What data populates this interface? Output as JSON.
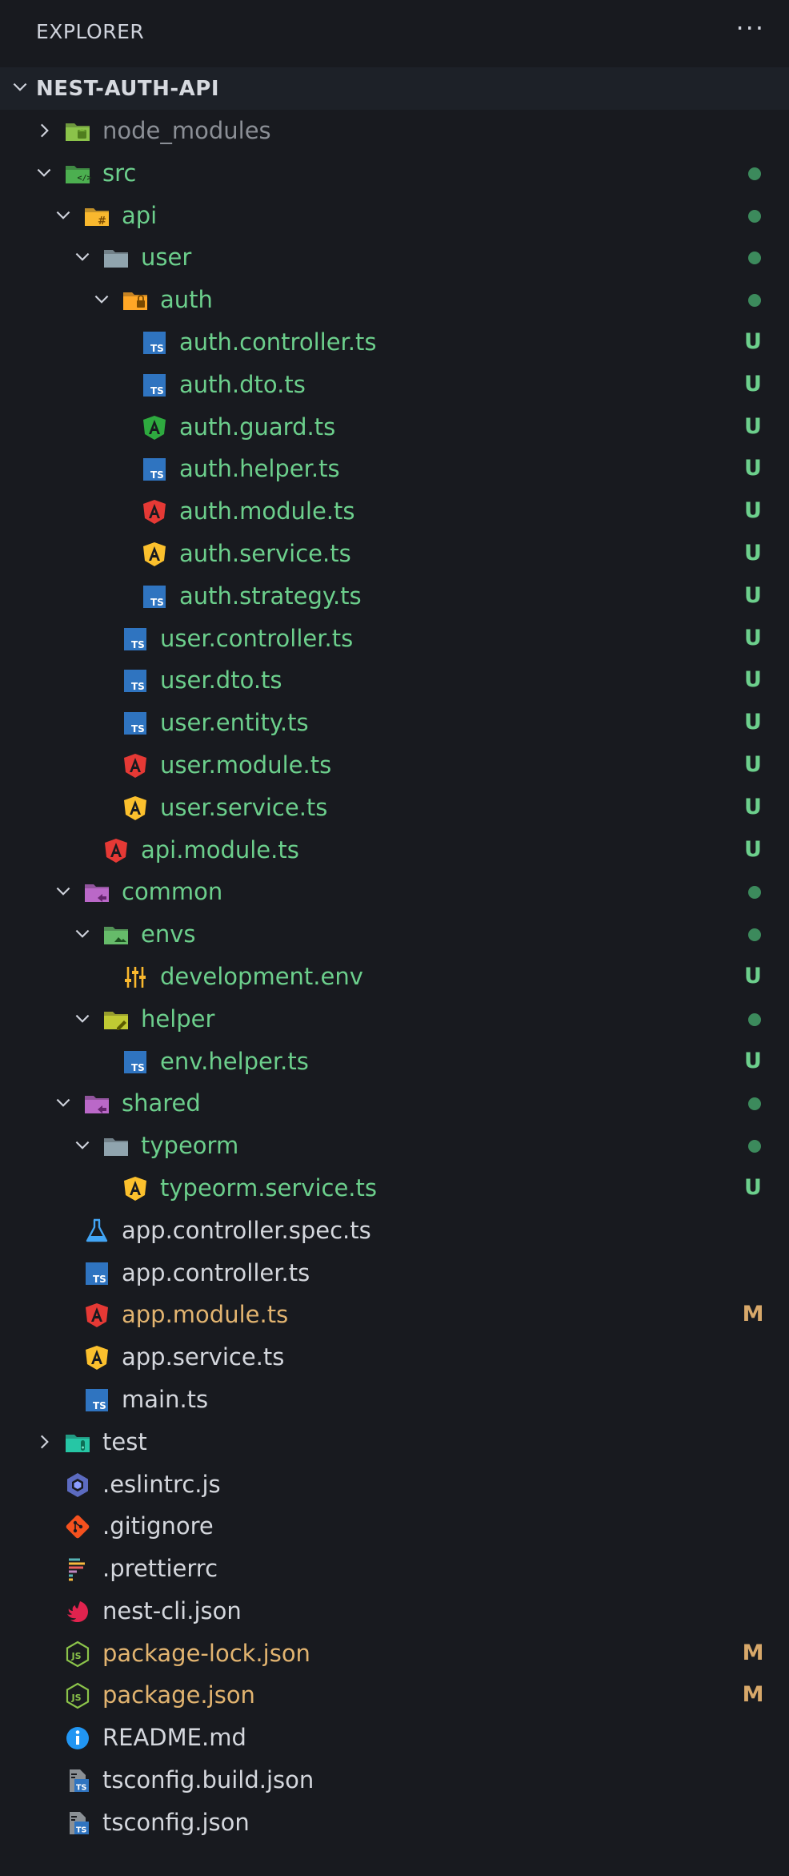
{
  "header": {
    "title": "EXPLORER",
    "more": "···"
  },
  "project": {
    "name": "NEST-AUTH-API"
  },
  "tree": [
    {
      "name": "node_modules",
      "depth": 0,
      "type": "folder",
      "expanded": false,
      "icon": "node-modules-folder-icon",
      "color": "grey",
      "status": ""
    },
    {
      "name": "src",
      "depth": 0,
      "type": "folder",
      "expanded": true,
      "icon": "src-folder-icon",
      "color": "green",
      "status": "dot"
    },
    {
      "name": "api",
      "depth": 1,
      "type": "folder",
      "expanded": true,
      "icon": "api-folder-icon",
      "color": "green",
      "status": "dot"
    },
    {
      "name": "user",
      "depth": 2,
      "type": "folder",
      "expanded": true,
      "icon": "folder-icon",
      "color": "green",
      "status": "dot"
    },
    {
      "name": "auth",
      "depth": 3,
      "type": "folder",
      "expanded": true,
      "icon": "auth-folder-icon",
      "color": "green",
      "status": "dot"
    },
    {
      "name": "auth.controller.ts",
      "depth": 4,
      "type": "file",
      "icon": "ts-icon",
      "color": "green",
      "status": "U"
    },
    {
      "name": "auth.dto.ts",
      "depth": 4,
      "type": "file",
      "icon": "ts-icon",
      "color": "green",
      "status": "U"
    },
    {
      "name": "auth.guard.ts",
      "depth": 4,
      "type": "file",
      "icon": "angular-guard-icon",
      "color": "green",
      "status": "U"
    },
    {
      "name": "auth.helper.ts",
      "depth": 4,
      "type": "file",
      "icon": "ts-icon",
      "color": "green",
      "status": "U"
    },
    {
      "name": "auth.module.ts",
      "depth": 4,
      "type": "file",
      "icon": "angular-module-icon",
      "color": "green",
      "status": "U"
    },
    {
      "name": "auth.service.ts",
      "depth": 4,
      "type": "file",
      "icon": "angular-service-icon",
      "color": "green",
      "status": "U"
    },
    {
      "name": "auth.strategy.ts",
      "depth": 4,
      "type": "file",
      "icon": "ts-icon",
      "color": "green",
      "status": "U"
    },
    {
      "name": "user.controller.ts",
      "depth": 3,
      "type": "file",
      "icon": "ts-icon",
      "color": "green",
      "status": "U"
    },
    {
      "name": "user.dto.ts",
      "depth": 3,
      "type": "file",
      "icon": "ts-icon",
      "color": "green",
      "status": "U"
    },
    {
      "name": "user.entity.ts",
      "depth": 3,
      "type": "file",
      "icon": "ts-icon",
      "color": "green",
      "status": "U"
    },
    {
      "name": "user.module.ts",
      "depth": 3,
      "type": "file",
      "icon": "angular-module-icon",
      "color": "green",
      "status": "U"
    },
    {
      "name": "user.service.ts",
      "depth": 3,
      "type": "file",
      "icon": "angular-service-icon",
      "color": "green",
      "status": "U"
    },
    {
      "name": "api.module.ts",
      "depth": 2,
      "type": "file",
      "icon": "angular-module-icon",
      "color": "green",
      "status": "U"
    },
    {
      "name": "common",
      "depth": 1,
      "type": "folder",
      "expanded": true,
      "icon": "common-folder-icon",
      "color": "green",
      "status": "dot"
    },
    {
      "name": "envs",
      "depth": 2,
      "type": "folder",
      "expanded": true,
      "icon": "envs-folder-icon",
      "color": "green",
      "status": "dot"
    },
    {
      "name": "development.env",
      "depth": 3,
      "type": "file",
      "icon": "env-settings-icon",
      "color": "green",
      "status": "U"
    },
    {
      "name": "helper",
      "depth": 2,
      "type": "folder",
      "expanded": true,
      "icon": "helper-folder-icon",
      "color": "green",
      "status": "dot"
    },
    {
      "name": "env.helper.ts",
      "depth": 3,
      "type": "file",
      "icon": "ts-icon",
      "color": "green",
      "status": "U"
    },
    {
      "name": "shared",
      "depth": 1,
      "type": "folder",
      "expanded": true,
      "icon": "shared-folder-icon",
      "color": "green",
      "status": "dot"
    },
    {
      "name": "typeorm",
      "depth": 2,
      "type": "folder",
      "expanded": true,
      "icon": "folder-icon",
      "color": "green",
      "status": "dot"
    },
    {
      "name": "typeorm.service.ts",
      "depth": 3,
      "type": "file",
      "icon": "angular-service-icon",
      "color": "green",
      "status": "U"
    },
    {
      "name": "app.controller.spec.ts",
      "depth": 1,
      "type": "file",
      "icon": "test-flask-icon",
      "color": "white",
      "status": ""
    },
    {
      "name": "app.controller.ts",
      "depth": 1,
      "type": "file",
      "icon": "ts-icon",
      "color": "white",
      "status": ""
    },
    {
      "name": "app.module.ts",
      "depth": 1,
      "type": "file",
      "icon": "angular-module-icon",
      "color": "orange",
      "status": "M"
    },
    {
      "name": "app.service.ts",
      "depth": 1,
      "type": "file",
      "icon": "angular-service-icon",
      "color": "white",
      "status": ""
    },
    {
      "name": "main.ts",
      "depth": 1,
      "type": "file",
      "icon": "ts-icon",
      "color": "white",
      "status": ""
    },
    {
      "name": "test",
      "depth": 0,
      "type": "folder",
      "expanded": false,
      "icon": "test-folder-icon",
      "color": "white",
      "status": ""
    },
    {
      "name": ".eslintrc.js",
      "depth": 0,
      "type": "file",
      "icon": "eslint-icon",
      "color": "white",
      "status": ""
    },
    {
      "name": ".gitignore",
      "depth": 0,
      "type": "file",
      "icon": "git-icon",
      "color": "white",
      "status": ""
    },
    {
      "name": ".prettierrc",
      "depth": 0,
      "type": "file",
      "icon": "prettier-icon",
      "color": "white",
      "status": ""
    },
    {
      "name": "nest-cli.json",
      "depth": 0,
      "type": "file",
      "icon": "nestjs-icon",
      "color": "white",
      "status": ""
    },
    {
      "name": "package-lock.json",
      "depth": 0,
      "type": "file",
      "icon": "nodejs-icon",
      "color": "orange",
      "status": "M"
    },
    {
      "name": "package.json",
      "depth": 0,
      "type": "file",
      "icon": "nodejs-icon",
      "color": "orange",
      "status": "M"
    },
    {
      "name": "README.md",
      "depth": 0,
      "type": "file",
      "icon": "info-icon",
      "color": "white",
      "status": ""
    },
    {
      "name": "tsconfig.build.json",
      "depth": 0,
      "type": "file",
      "icon": "tsconfig-icon",
      "color": "white",
      "status": ""
    },
    {
      "name": "tsconfig.json",
      "depth": 0,
      "type": "file",
      "icon": "tsconfig-icon",
      "color": "white",
      "status": ""
    }
  ]
}
